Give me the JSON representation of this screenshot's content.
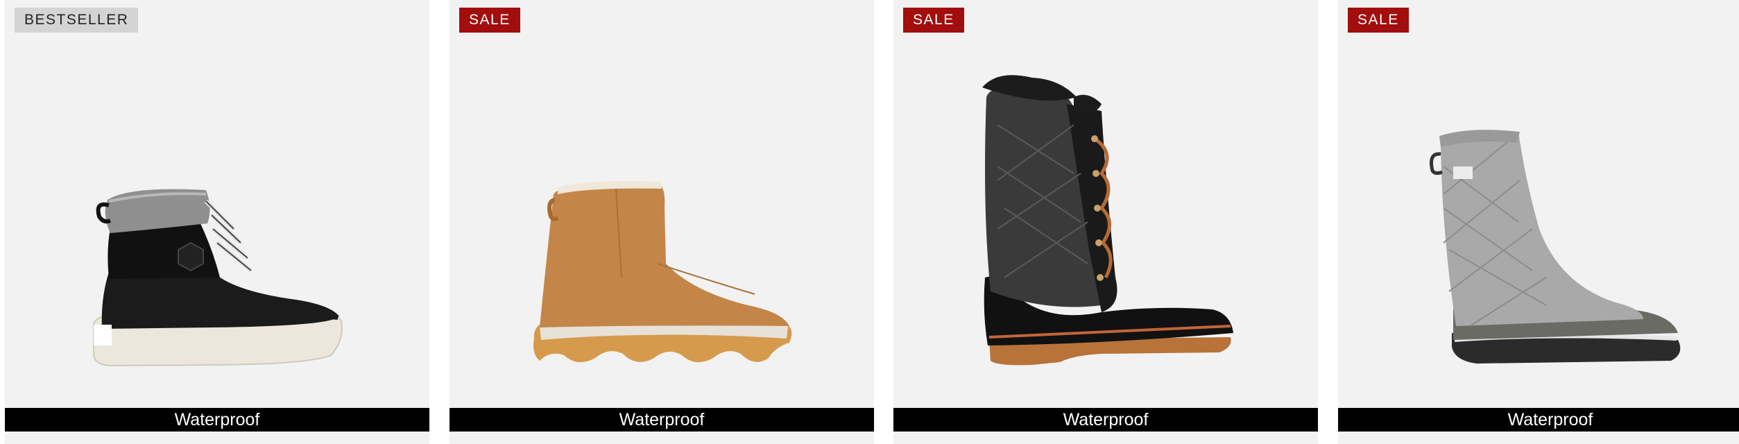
{
  "products": [
    {
      "badge": "BESTSELLER",
      "badge_type": "bestseller",
      "feature": "Waterproof",
      "image_icon": "duck-boot-black-grey-icon"
    },
    {
      "badge": "SALE",
      "badge_type": "sale",
      "feature": "Waterproof",
      "image_icon": "tan-suede-ankle-boot-icon"
    },
    {
      "badge": "SALE",
      "badge_type": "sale",
      "feature": "Waterproof",
      "image_icon": "tall-black-felt-lace-up-boot-icon"
    },
    {
      "badge": "SALE",
      "badge_type": "sale",
      "feature": "Waterproof",
      "image_icon": "tall-grey-quilted-boot-icon"
    }
  ],
  "colors": {
    "card_bg": "#f2f2f2",
    "sale_badge": "#a20d0d",
    "bestseller_badge": "#d4d4d4",
    "feature_bar": "#000000"
  }
}
